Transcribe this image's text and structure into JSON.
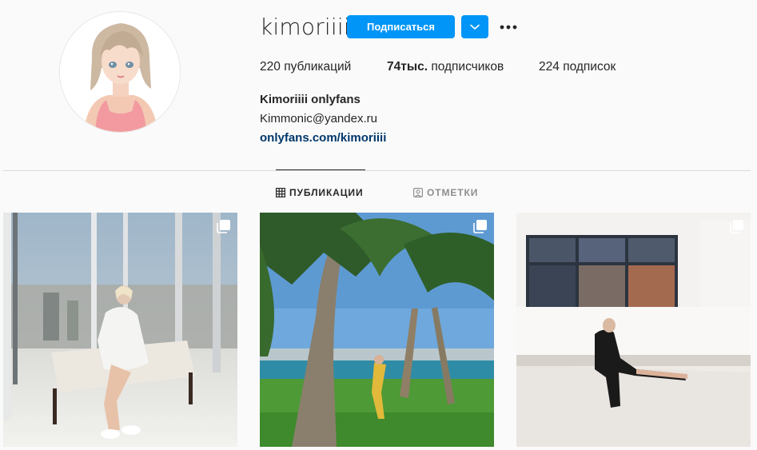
{
  "profile": {
    "username": "kimoriiii",
    "full_name": "Kimoriiii onlyfans",
    "email": "Kimmonic@yandex.ru",
    "link": "onlyfans.com/kimoriiii"
  },
  "actions": {
    "follow_label": "Подписаться"
  },
  "stats": {
    "posts_count": "220",
    "posts_label": "публикаций",
    "followers_count": "74тыс.",
    "followers_label": "подписчиков",
    "following_count": "224",
    "following_label": "подписок"
  },
  "tabs": {
    "posts": "ПУБЛИКАЦИИ",
    "tagged": "ОТМЕТКИ"
  },
  "icons": {
    "dropdown": "chevron-down-icon",
    "more": "more-options-icon",
    "grid": "grid-icon",
    "tagged": "tagged-icon",
    "multi": "multiple-posts-icon"
  },
  "colors": {
    "accent": "#0095f6",
    "link": "#00376b",
    "text": "#262626",
    "muted": "#8e8e8e",
    "background": "#fafafa"
  }
}
